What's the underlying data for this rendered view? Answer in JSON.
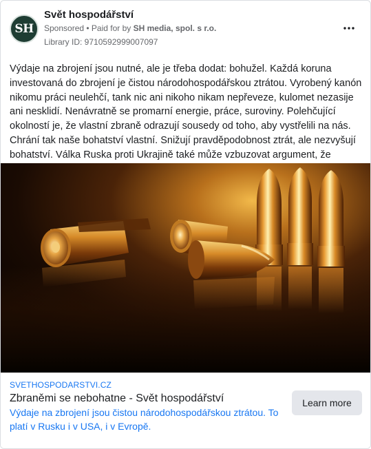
{
  "header": {
    "avatar_text": "SH",
    "page_name": "Svět hospodářství",
    "sponsored_label": "Sponsored",
    "paid_for_prefix": " • Paid for by ",
    "paid_for_by": "SH media, spol. s r.o.",
    "library_id": "Library ID: 9710592999007097",
    "more_icon": "more-horizontal-icon"
  },
  "post": {
    "body": "Výdaje na zbrojení jsou nutné, ale je třeba dodat: bohužel. Každá koruna investovaná do zbrojení je čistou národohospodářskou ztrátou. Vyrobený kanón nikomu práci neulehčí, tank nic ani nikoho nikam nepřeveze, kulomet nezasije ani nesklidí. Nenávratně se promarní energie, práce, suroviny. Polehčující okolností je, že vlastní zbraně odrazují sousedy od toho, aby vystřelili na nás. Chrání tak naše bohatství vlastní. Snižují pravděpodobnost ztrát, ale nezvyšují bohatství. Válka Ruska proti Ukrajině také může vzbuzovat argument, že zbraněmi se dobývá cizí…",
    "image_icon": "bullets-photo"
  },
  "link": {
    "domain": "SVETHOSPODARSTVI.CZ",
    "title": "Zbraněmi se nebohatne - Svět hospodářství",
    "description": "Výdaje na zbrojení jsou čistou národohospodářskou ztrátou. To platí v Rusku i v USA, i v Evropě.",
    "cta_label": "Learn more"
  },
  "colors": {
    "link_blue": "#1877f2",
    "meta_gray": "#65676b",
    "avatar_green": "#1e3d33",
    "button_gray": "#e4e6eb"
  }
}
